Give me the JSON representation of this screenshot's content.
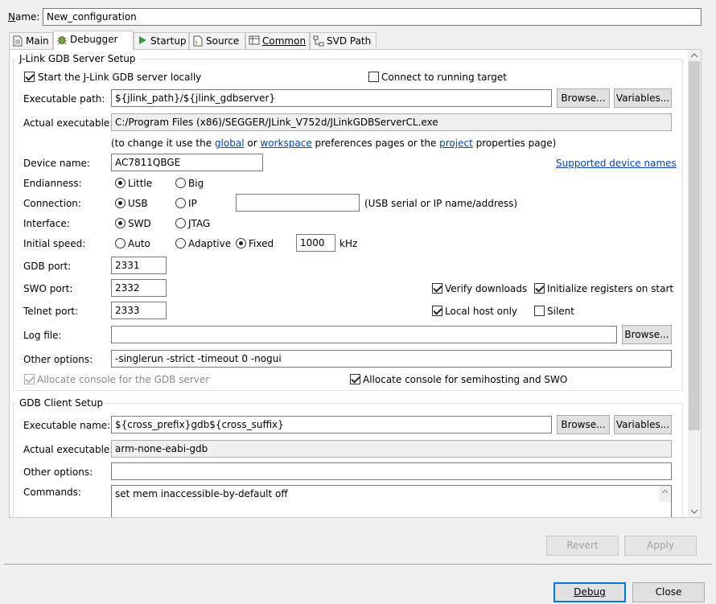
{
  "name": {
    "label": "Name:",
    "value": "New_configuration"
  },
  "tabs": [
    {
      "label": "Main",
      "icon": "document-icon"
    },
    {
      "label": "Debugger",
      "icon": "bug-icon"
    },
    {
      "label": "Startup",
      "icon": "play-icon"
    },
    {
      "label": "Source",
      "icon": "source-icon"
    },
    {
      "label": "Common",
      "icon": "common-icon"
    },
    {
      "label": "SVD Path",
      "icon": "tree-icon"
    }
  ],
  "server": {
    "title": "J-Link GDB Server Setup",
    "start_locally": "Start the J-Link GDB server locally",
    "connect_running": "Connect to running target",
    "exe_path_label": "Executable path:",
    "exe_path_value": "${jlink_path}/${jlink_gdbserver}",
    "browse": "Browse...",
    "variables": "Variables...",
    "actual_label": "Actual executable:",
    "actual_value": "C:/Program Files (x86)/SEGGER/JLink_V752d/JLinkGDBServerCL.exe",
    "hint_pre": "(to change it use the ",
    "hint_global": "global",
    "hint_or": " or ",
    "hint_workspace": "workspace",
    "hint_mid": " preferences pages or the ",
    "hint_project": "project",
    "hint_post": " properties page)",
    "device_label": "Device name:",
    "device_value": "AC7811QBGE",
    "supported_devices": "Supported device names",
    "endian_label": "Endianness:",
    "endian_little": "Little",
    "endian_big": "Big",
    "conn_label": "Connection:",
    "conn_usb": "USB",
    "conn_ip": "IP",
    "conn_value": "",
    "conn_hint": "(USB serial or IP name/address)",
    "iface_label": "Interface:",
    "iface_swd": "SWD",
    "iface_jtag": "JTAG",
    "speed_label": "Initial speed:",
    "speed_auto": "Auto",
    "speed_adaptive": "Adaptive",
    "speed_fixed": "Fixed",
    "speed_value": "1000",
    "speed_unit": "kHz",
    "gdb_port_label": "GDB port:",
    "gdb_port_value": "2331",
    "swo_port_label": "SWO port:",
    "swo_port_value": "2332",
    "telnet_port_label": "Telnet port:",
    "telnet_port_value": "2333",
    "verify_downloads": "Verify downloads",
    "init_registers": "Initialize registers on start",
    "local_host_only": "Local host only",
    "silent": "Silent",
    "log_label": "Log file:",
    "log_value": "",
    "other_label": "Other options:",
    "other_value": "-singlerun -strict -timeout 0 -nogui",
    "alloc_console": "Allocate console for the GDB server",
    "alloc_semihosting": "Allocate console for semihosting and SWO"
  },
  "client": {
    "title": "GDB Client Setup",
    "exe_label": "Executable name:",
    "exe_value": "${cross_prefix}gdb${cross_suffix}",
    "browse": "Browse...",
    "variables": "Variables...",
    "actual_label": "Actual executable:",
    "actual_value": "arm-none-eabi-gdb",
    "other_label": "Other options:",
    "other_value": "",
    "commands_label": "Commands:",
    "commands_value": "set mem inaccessible-by-default off"
  },
  "actions": {
    "revert": "Revert",
    "apply": "Apply",
    "debug": "Debug",
    "close": "Close"
  }
}
